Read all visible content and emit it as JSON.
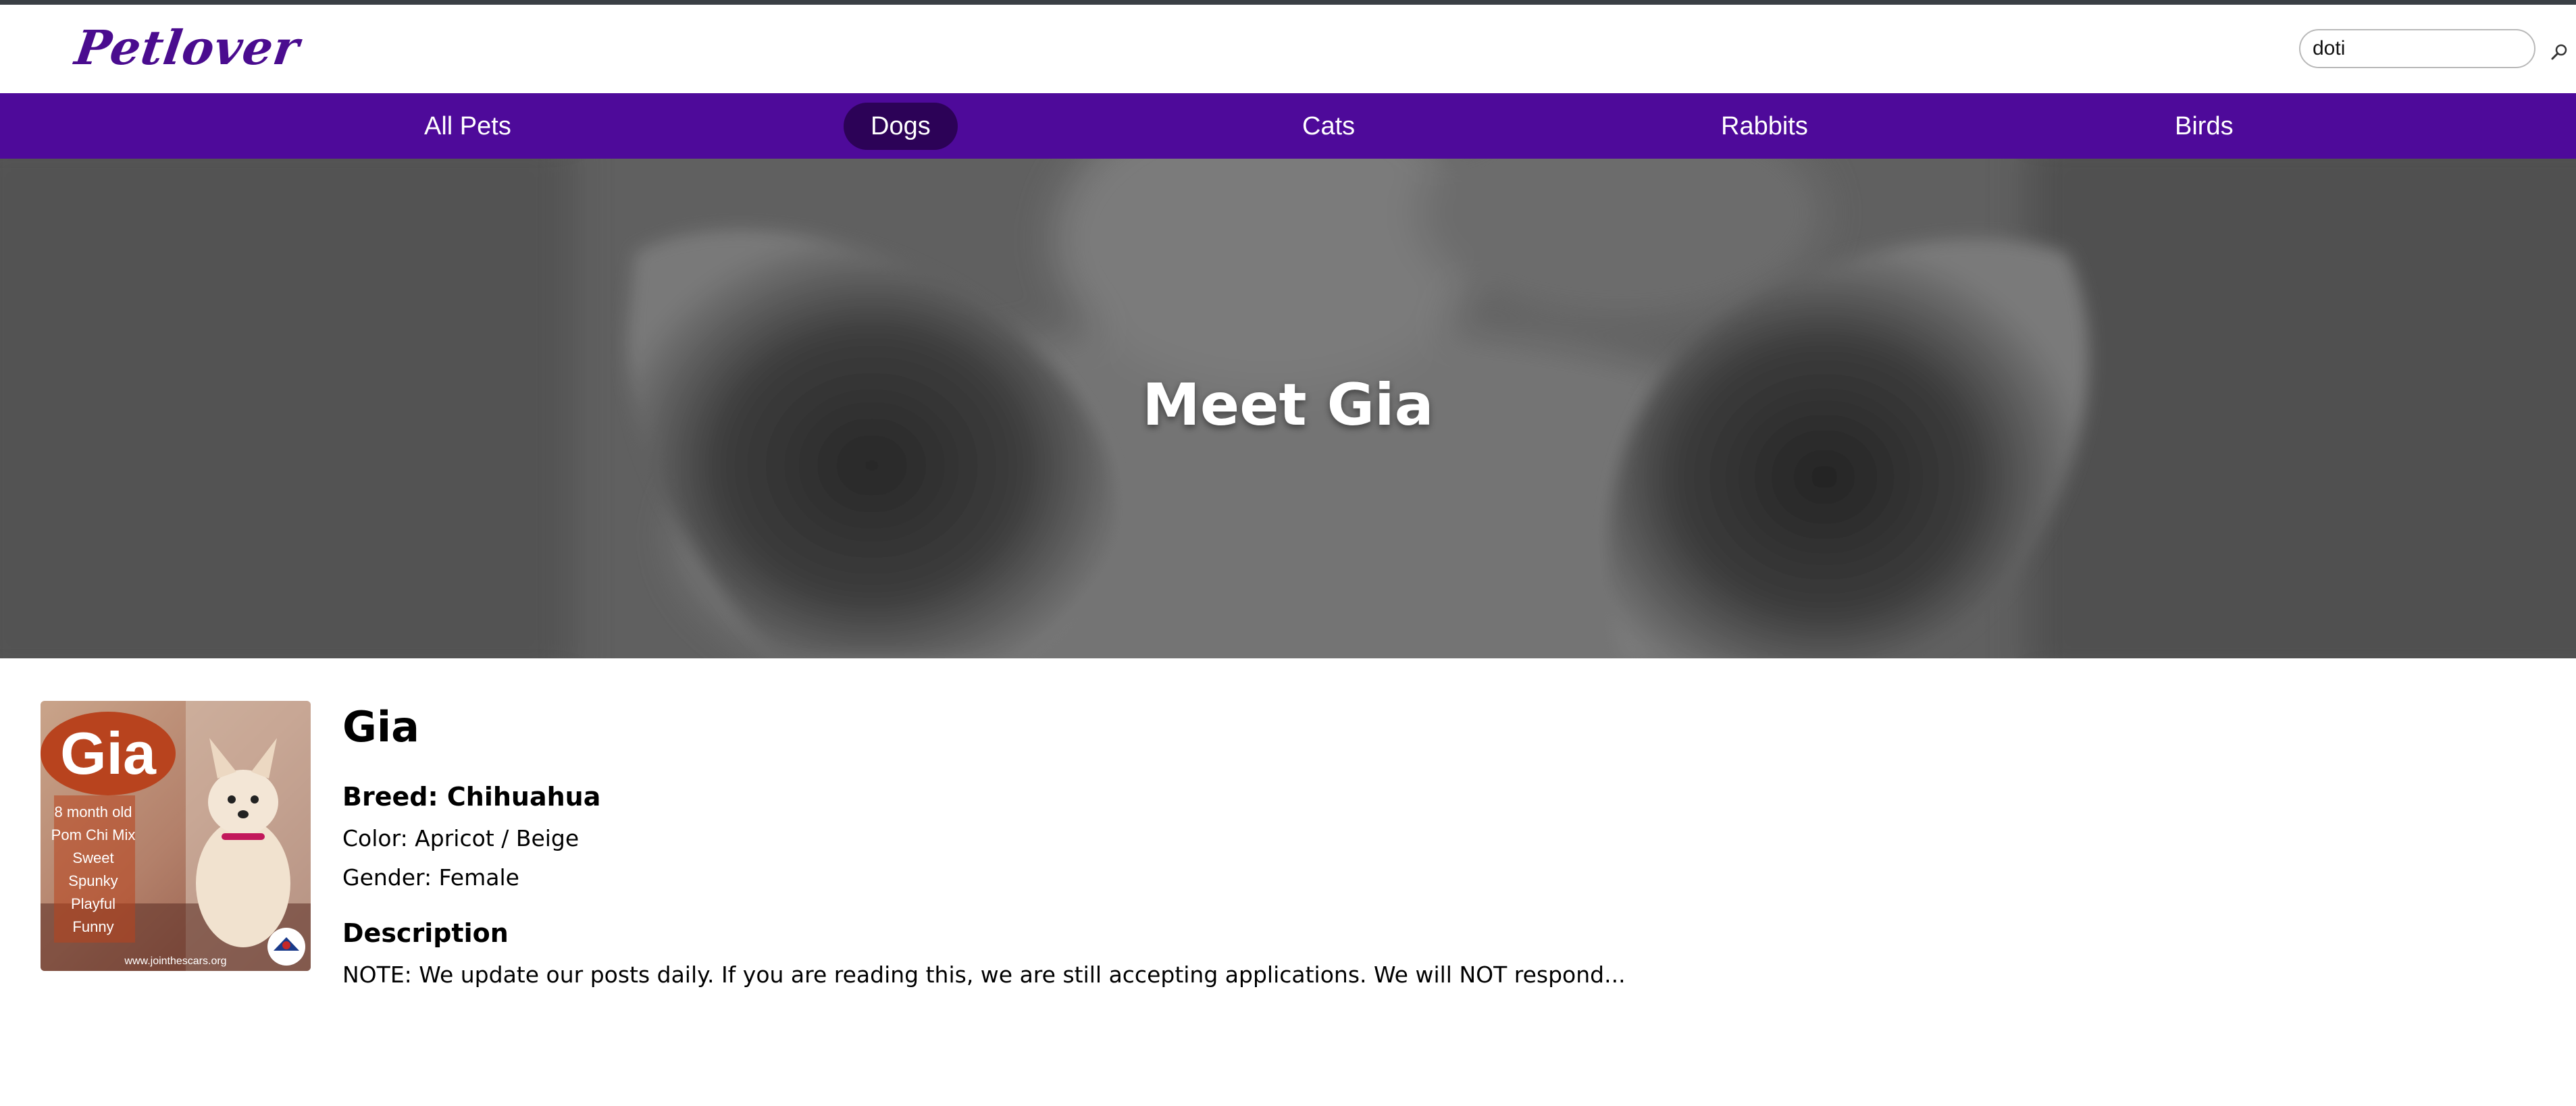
{
  "header": {
    "logo": "Petlover",
    "search": {
      "value": "doti",
      "placeholder": ""
    },
    "search_icon": "search-icon"
  },
  "nav": {
    "items": [
      {
        "label": "All Pets",
        "active": false
      },
      {
        "label": "Dogs",
        "active": true
      },
      {
        "label": "Cats",
        "active": false
      },
      {
        "label": "Rabbits",
        "active": false
      },
      {
        "label": "Birds",
        "active": false
      }
    ]
  },
  "hero": {
    "title": "Meet Gia"
  },
  "pet": {
    "photo": {
      "title": "Gia",
      "lines": [
        "8 month old",
        "Pom Chi Mix",
        "Sweet",
        "Spunky",
        "Playful",
        "Funny"
      ],
      "url": "www.jointhescars.org"
    },
    "name": "Gia",
    "breed": "Breed: Chihuahua",
    "color": "Color: Apricot / Beige",
    "gender": "Gender: Female",
    "description_heading": "Description",
    "description": "NOTE: We update our posts daily. If you are reading this, we are still accepting applications. We will NOT respond..."
  },
  "colors": {
    "brand": "#4a0c8f",
    "nav_bg": "#4e0a9a",
    "nav_active": "#2c0257"
  }
}
